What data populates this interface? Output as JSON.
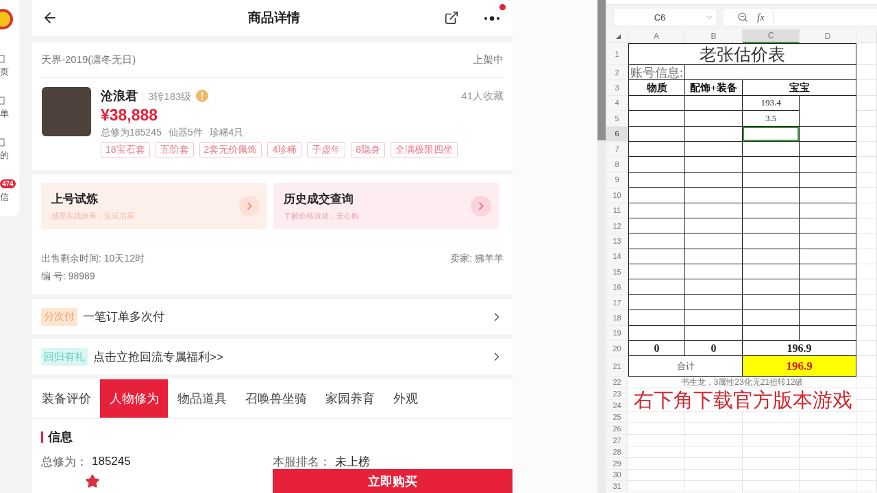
{
  "side_nav": {
    "items": [
      {
        "label": "页"
      },
      {
        "label": "单"
      },
      {
        "label": "的"
      },
      {
        "label": "信",
        "badge": "474"
      }
    ]
  },
  "header": {
    "title": "商品详情",
    "notification_dot": true
  },
  "listing": {
    "server": "天界-2019(凛冬无日)",
    "status": "上架中",
    "name": "沧浪君",
    "level": "3转183级",
    "favorites": "41人收藏",
    "price": "¥38,888",
    "stats": [
      "总修为185245",
      "仙器5件",
      "珍稀4只"
    ],
    "tags": [
      "18宝石套",
      "五阶套",
      "2套无价佩饰",
      "4珍稀",
      "子虚年",
      "8隐身",
      "全满极限四坐"
    ]
  },
  "promos": [
    {
      "title": "上号试炼",
      "subtitle": "感受实战效果，先试后买",
      "color": "#fdf0eb"
    },
    {
      "title": "历史成交查询",
      "subtitle": "了解价格波动，安心购",
      "color": "#fdedf0"
    }
  ],
  "sale_info": {
    "time_left": "出售剩余时间: 10天12时",
    "seller": "卖家: 狒羊羊",
    "serial": "编 号: 98989"
  },
  "banners": [
    {
      "kind": "installment",
      "badge": "分次付",
      "text": "一笔订单多次付"
    },
    {
      "kind": "gift",
      "badge": "回归有礼",
      "text": "点击立抢回流专属福利>>"
    }
  ],
  "tabs": [
    {
      "label": "装备评价",
      "selected": false
    },
    {
      "label": "人物修为",
      "selected": true
    },
    {
      "label": "物品道具",
      "selected": false
    },
    {
      "label": "召唤兽坐骑",
      "selected": false
    },
    {
      "label": "家园养育",
      "selected": false
    },
    {
      "label": "外观",
      "selected": false
    }
  ],
  "info": {
    "title": "信息",
    "fields": [
      {
        "label": "总修为：",
        "value": "185245"
      },
      {
        "label": "本服排名：",
        "value": "未上榜"
      }
    ]
  },
  "bottom_bar": {
    "buy_label": "立即购买"
  },
  "sheet": {
    "name_box": "C6",
    "formula_label": "fx",
    "columns": [
      {
        "label": "A",
        "selected": false
      },
      {
        "label": "B",
        "selected": false
      },
      {
        "label": "C",
        "selected": true
      },
      {
        "label": "D",
        "selected": false
      }
    ],
    "rows": [
      {
        "label": "1",
        "selected": false
      },
      {
        "label": "2",
        "selected": false
      },
      {
        "label": "3",
        "selected": false
      },
      {
        "label": "4",
        "selected": false
      },
      {
        "label": "5",
        "selected": false
      },
      {
        "label": "6",
        "selected": true
      },
      {
        "label": "7",
        "selected": false
      },
      {
        "label": "8",
        "selected": false
      },
      {
        "label": "9",
        "selected": false
      },
      {
        "label": "10",
        "selected": false
      },
      {
        "label": "11",
        "selected": false
      },
      {
        "label": "12",
        "selected": false
      },
      {
        "label": "13",
        "selected": false
      },
      {
        "label": "14",
        "selected": false
      },
      {
        "label": "15",
        "selected": false
      },
      {
        "label": "16",
        "selected": false
      },
      {
        "label": "17",
        "selected": false
      },
      {
        "label": "18",
        "selected": false
      },
      {
        "label": "19",
        "selected": false
      },
      {
        "label": "20",
        "selected": false
      },
      {
        "label": "21",
        "selected": false
      },
      {
        "label": "22",
        "selected": false
      },
      {
        "label": "23",
        "selected": false
      },
      {
        "label": "24",
        "selected": false
      },
      {
        "label": "25",
        "selected": false
      },
      {
        "label": "26",
        "selected": false
      },
      {
        "label": "27",
        "selected": false
      },
      {
        "label": "28",
        "selected": false
      },
      {
        "label": "29",
        "selected": false
      },
      {
        "label": "30",
        "selected": false
      },
      {
        "label": "31",
        "selected": false
      }
    ],
    "title": "老张估价表",
    "account_label": "账号信息:",
    "headers": [
      "物质",
      "配饰+装备",
      "宝宝"
    ],
    "baby_values": [
      "193.4",
      "3.5"
    ],
    "subtotals": [
      "0",
      "0",
      "196.9"
    ],
    "total_label": "合计",
    "total": "196.9",
    "note": "书生龙，3属性23化无21扭转12破"
  },
  "overlay_caption": "右下角下载官方版本游戏"
}
